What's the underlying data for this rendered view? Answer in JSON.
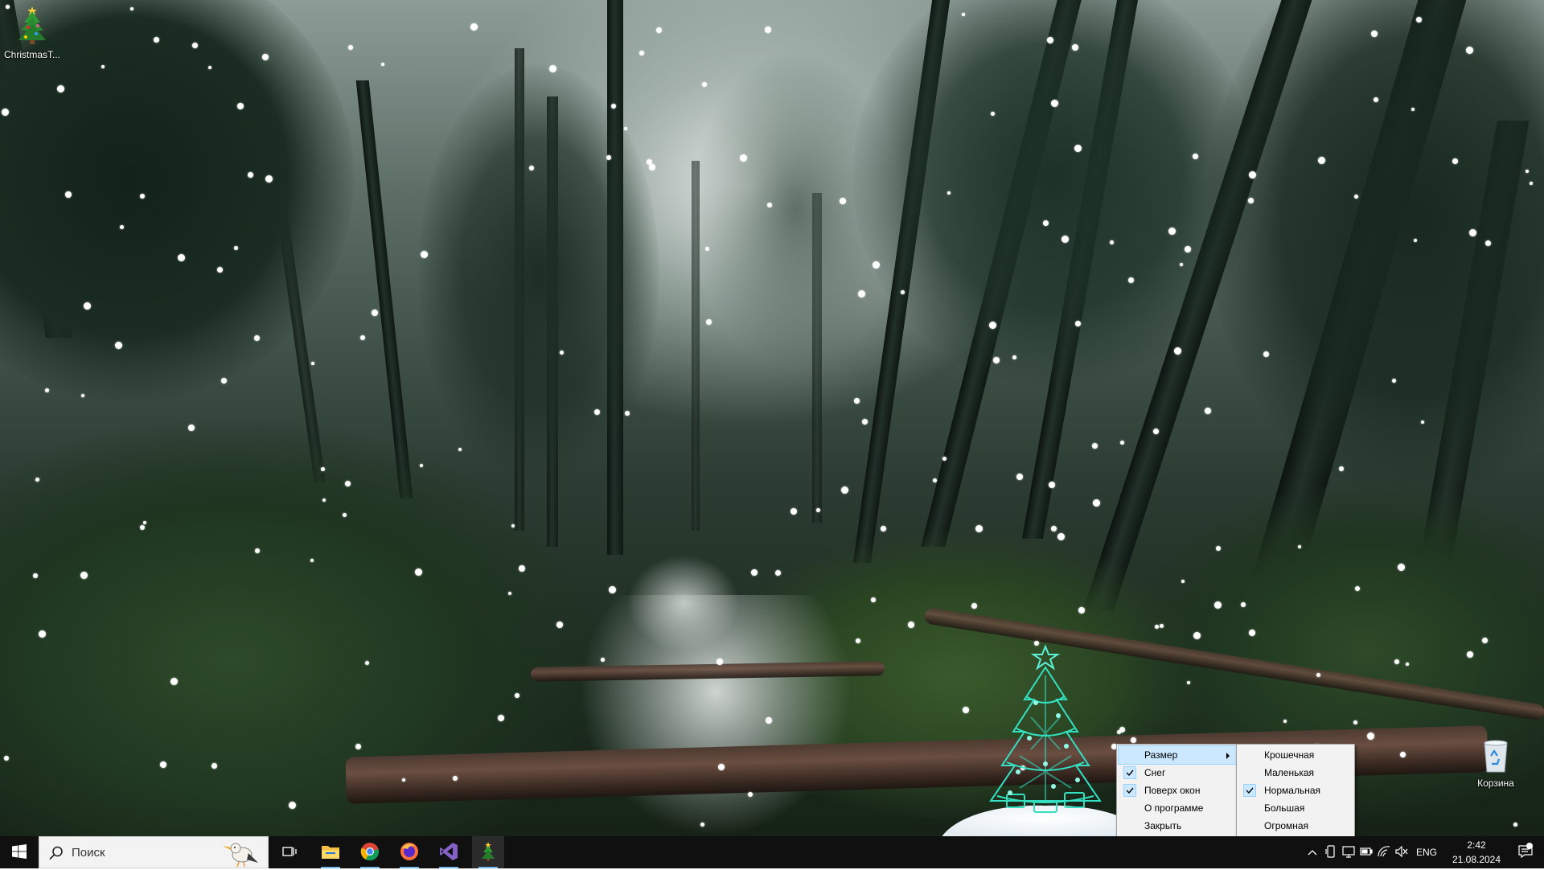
{
  "desktop": {
    "icons": [
      {
        "label": "ChristmasT...",
        "icon": "christmas-tree-icon"
      },
      {
        "label": "Корзина",
        "icon": "recycle-bin-icon"
      }
    ]
  },
  "context_menu": {
    "items": [
      {
        "label": "Размер",
        "checked": false,
        "has_submenu": true,
        "highlighted": true
      },
      {
        "label": "Снег",
        "checked": true
      },
      {
        "label": "Поверх окон",
        "checked": true
      },
      {
        "label": "О программе",
        "checked": false
      },
      {
        "label": "Закрыть",
        "checked": false
      }
    ]
  },
  "size_submenu": {
    "items": [
      {
        "label": "Крошечная",
        "checked": false
      },
      {
        "label": "Маленькая",
        "checked": false
      },
      {
        "label": "Нормальная",
        "checked": true
      },
      {
        "label": "Большая",
        "checked": false
      },
      {
        "label": "Огромная",
        "checked": false
      }
    ]
  },
  "taskbar": {
    "search_placeholder": "Поиск",
    "apps": [
      {
        "name": "file-explorer",
        "icon": "folder-icon",
        "running": true
      },
      {
        "name": "chrome",
        "icon": "chrome-icon",
        "running": true
      },
      {
        "name": "firefox",
        "icon": "firefox-icon",
        "running": true
      },
      {
        "name": "visual-studio",
        "icon": "visual-studio-icon",
        "running": true
      },
      {
        "name": "christmas-tree",
        "icon": "christmas-tree-icon",
        "running": true,
        "active": true
      }
    ],
    "tray": {
      "language": "ENG",
      "time": "2:42",
      "date": "21.08.2024"
    }
  },
  "colors": {
    "accent": "#76b9ed",
    "menu_highlight": "#cce8ff",
    "taskbar": "#101010"
  }
}
